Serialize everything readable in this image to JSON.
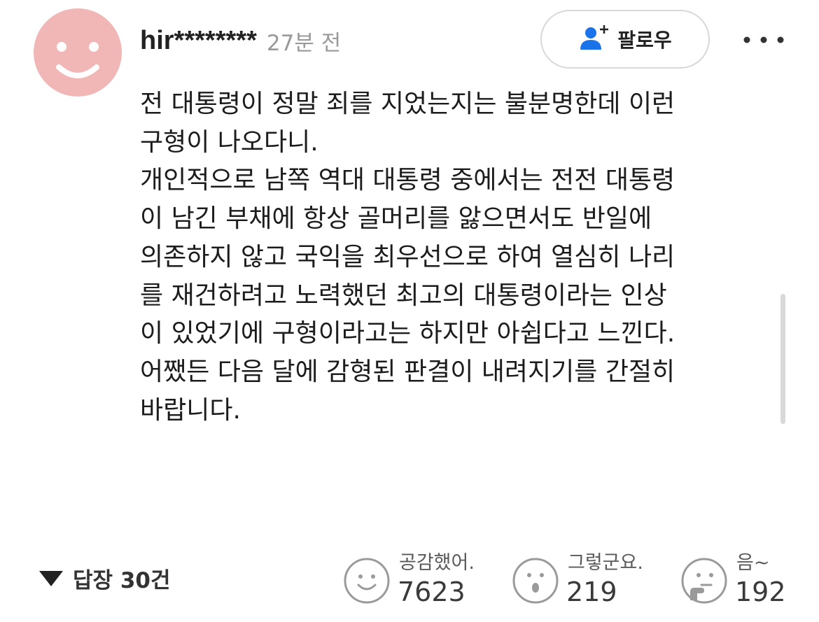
{
  "comment": {
    "username": "hir********",
    "timestamp": "27분 전",
    "follow_label": "팔로우",
    "body_lines": [
      "전 대통령이 정말 죄를 지었는지는 불분명한데 이런",
      "구형이 나오다니.",
      "개인적으로 남쪽 역대 대통령 중에서는 전전 대통령",
      "이 남긴 부채에 항상 골머리를 앓으면서도 반일에",
      "의존하지 않고 국익을 최우선으로 하여 열심히 나리",
      "를 재건하려고 노력했던 최고의 대통령이라는 인상",
      "이 있었기에 구형이라고는 하지만 아쉽다고 느낀다.",
      "어쨌든 다음 달에 감형된 판결이 내려지기를 간절히",
      "바랍니다."
    ]
  },
  "replies": {
    "label": "답장 30건"
  },
  "reactions": [
    {
      "label": "공감했어.",
      "count": "7623",
      "icon": "smile-face-icon"
    },
    {
      "label": "그렇군요.",
      "count": "219",
      "icon": "surprised-face-icon"
    },
    {
      "label": "음~",
      "count": "192",
      "icon": "thinking-face-icon"
    }
  ],
  "colors": {
    "avatar_bg": "#f1b7b7",
    "avatar_face": "#ffffff",
    "follow_icon": "#1a73e8",
    "timestamp": "#9a9a9a",
    "reaction_icon": "#9a9a9a"
  },
  "icons": {
    "avatar": "smiley-avatar-icon",
    "follow": "person-plus-icon",
    "more": "more-dots-icon",
    "replies_toggle": "triangle-down-icon"
  }
}
